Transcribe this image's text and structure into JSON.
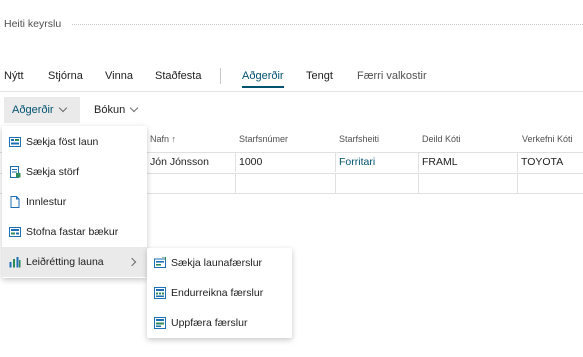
{
  "header": {
    "title_label": "Heiti keyrslu"
  },
  "actions": {
    "new": "Nýtt",
    "manage": "Stjórna",
    "process": "Vinna",
    "post": "Staðfesta",
    "actions": "Aðgerðir",
    "related": "Tengt",
    "fewer": "Færri valkostir"
  },
  "subbar": {
    "actions": "Aðgerðir",
    "bookings": "Bókun"
  },
  "grid": {
    "columns": [
      "Nafn ↑",
      "Starfsnúmer",
      "Starfsheiti",
      "Deild Kóti",
      "Verkefni Kóti"
    ],
    "rows": [
      [
        "Jón Jónsson",
        "1000",
        "Forritari",
        "FRAML",
        "TOYOTA"
      ]
    ]
  },
  "menu": {
    "items": [
      {
        "label": "Sækja föst laun",
        "icon": "fetch-fixed-pay-icon"
      },
      {
        "label": "Sækja störf",
        "icon": "fetch-jobs-icon"
      },
      {
        "label": "Innlestur",
        "icon": "import-document-icon"
      },
      {
        "label": "Stofna fastar bækur",
        "icon": "create-journals-icon"
      },
      {
        "label": "Leiðrétting launa",
        "icon": "payroll-correction-icon"
      }
    ]
  },
  "submenu": {
    "items": [
      {
        "label": "Sækja launafærslur",
        "icon": "fetch-payroll-entries-icon"
      },
      {
        "label": "Endurreikna færslur",
        "icon": "recalculate-entries-icon"
      },
      {
        "label": "Uppfæra færslur",
        "icon": "update-entries-icon"
      }
    ]
  },
  "colors": {
    "accent": "#00526e",
    "icon_blue": "#1f6fb5",
    "icon_green": "#2e8b57"
  }
}
